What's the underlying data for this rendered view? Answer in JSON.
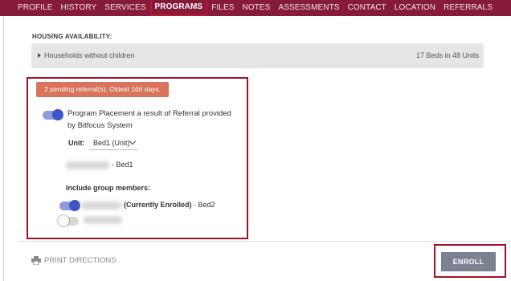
{
  "nav": {
    "tabs": [
      "PROFILE",
      "HISTORY",
      "SERVICES",
      "PROGRAMS",
      "FILES",
      "NOTES",
      "ASSESSMENTS",
      "CONTACT",
      "LOCATION",
      "REFERRALS"
    ],
    "active_tab": "PROGRAMS"
  },
  "housing": {
    "section_label": "HOUSING AVAILABILITY:",
    "row_label": "Households without children",
    "row_count": "17 Beds in 48 Units"
  },
  "referral": {
    "pending_badge": "2 pending referral(s). Oldest 166 days.",
    "placement_toggle_on": true,
    "placement_text": "Program Placement a result of Referral provided by Bitfocus System",
    "unit_label": "Unit:",
    "unit_value": "Bed1 (Unit)",
    "client_bed": "- Bed1",
    "group_members_label": "Include group members:",
    "members": [
      {
        "status": "(Currently Enrolled)",
        "bed": " - Bed2",
        "toggle_on": true
      },
      {
        "status": "",
        "bed": "",
        "toggle_on": false
      }
    ]
  },
  "footer": {
    "print_directions": "PRINT DIRECTIONS",
    "enroll_button": "ENROLL"
  },
  "colors": {
    "nav_bg": "#861a3b",
    "highlight_border": "#a30f23",
    "badge_bg": "#d9735a",
    "toggle_on": "#3e55c6",
    "enroll_bg": "#7a8190"
  }
}
